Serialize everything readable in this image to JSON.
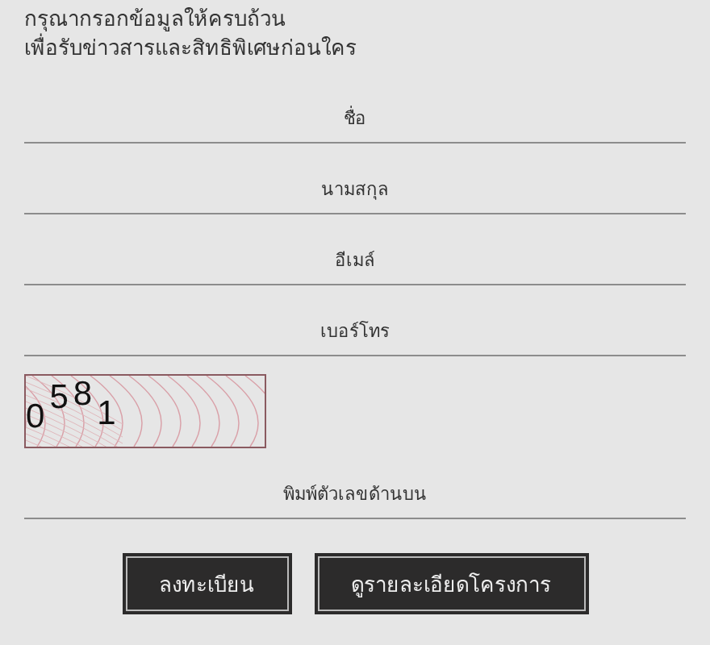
{
  "intro": [
    "กรุณากรอกข้อมูลให้ครบถ้วน",
    "เพื่อรับข่าวสารและสิทธิพิเศษก่อนใคร"
  ],
  "fields": [
    {
      "placeholder": "ชื่อ"
    },
    {
      "placeholder": "นามสกุล"
    },
    {
      "placeholder": "อีเมล์"
    },
    {
      "placeholder": "เบอร์โทร"
    }
  ],
  "captcha": {
    "digits": [
      "0",
      "5",
      "8",
      "1"
    ]
  },
  "captcha_field": {
    "placeholder": "พิมพ์ตัวเลขด้านบน"
  },
  "buttons": [
    "ลงทะเบียน",
    "ดูรายละเอียดโครงการ"
  ]
}
